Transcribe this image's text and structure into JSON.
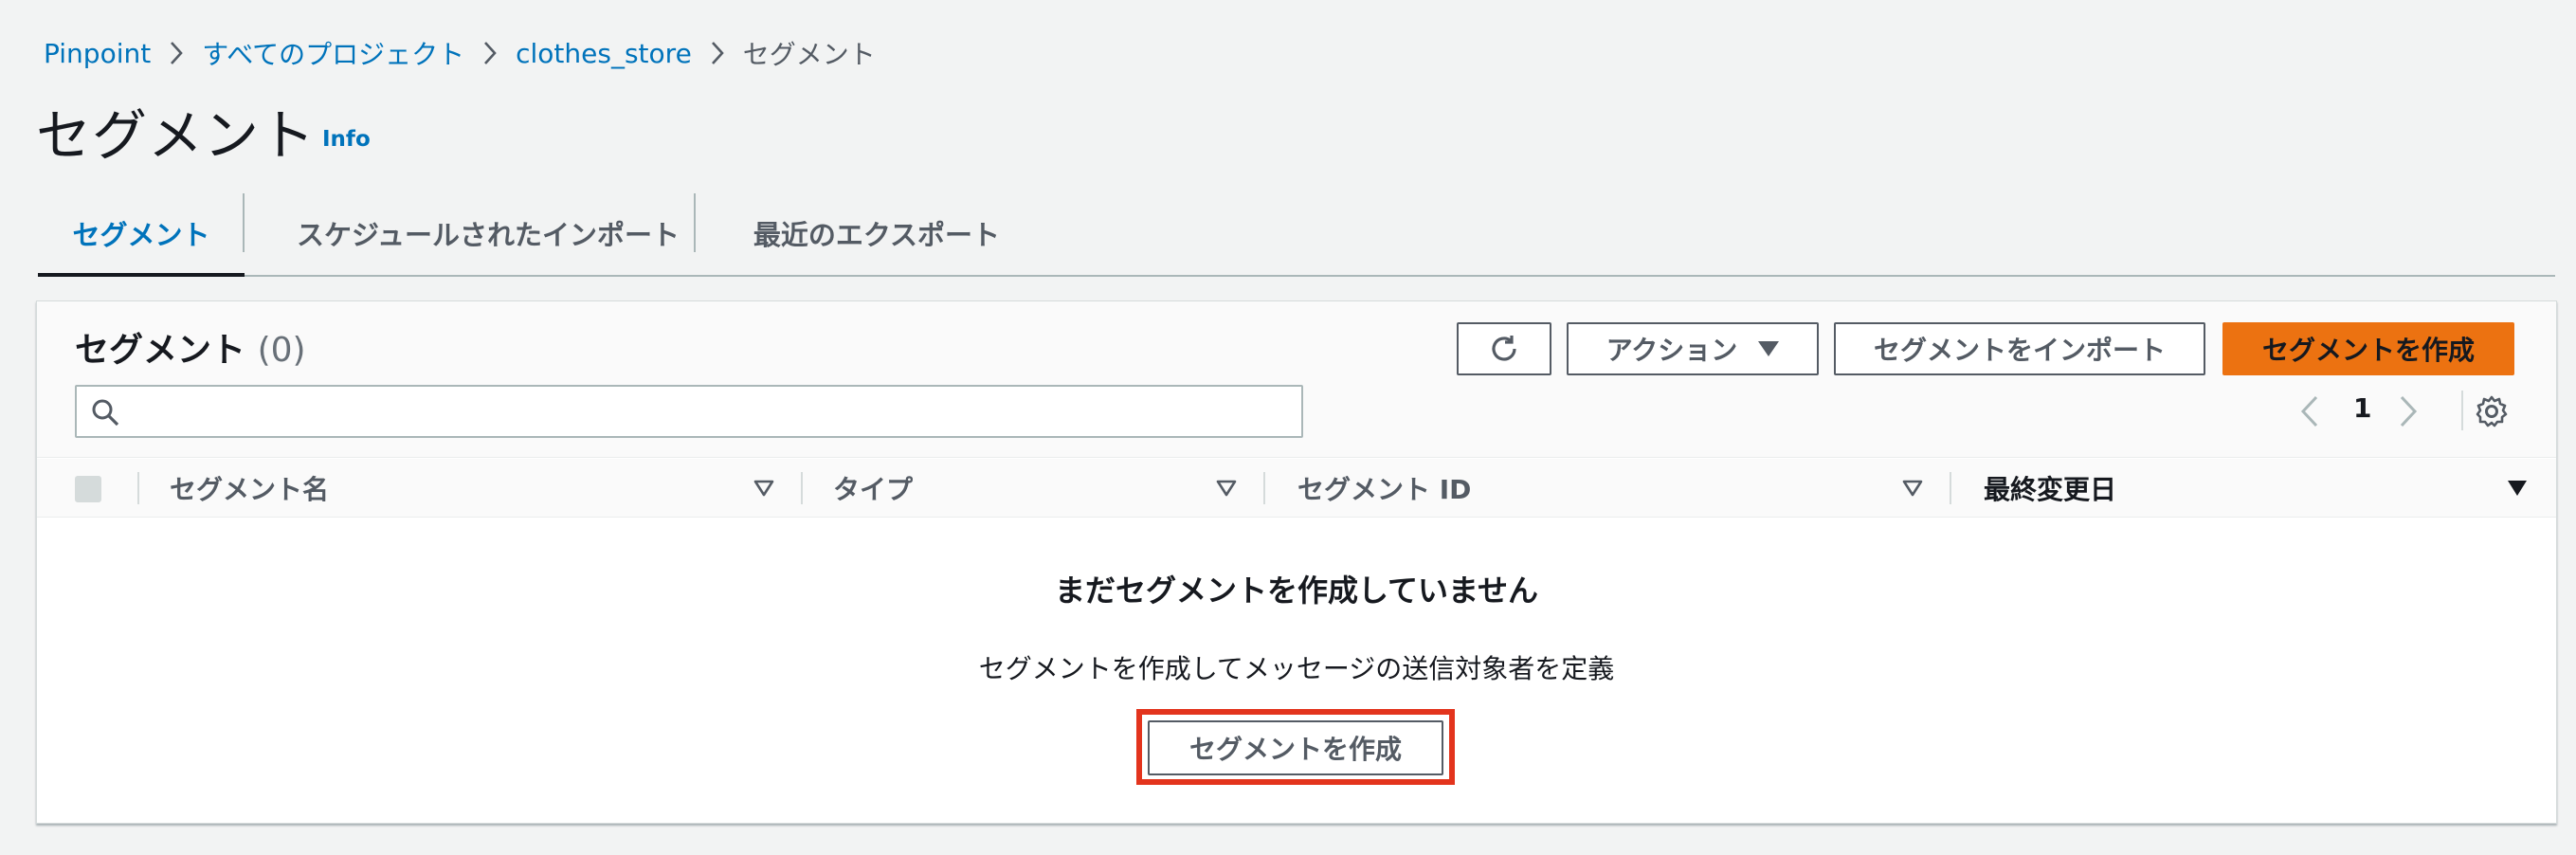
{
  "breadcrumb": {
    "items": [
      "Pinpoint",
      "すべてのプロジェクト",
      "clothes_store"
    ],
    "current": "セグメント"
  },
  "page": {
    "title": "セグメント",
    "info_label": "Info"
  },
  "tabs": [
    {
      "label": "セグメント",
      "active": true
    },
    {
      "label": "スケジュールされたインポート",
      "active": false
    },
    {
      "label": "最近のエクスポート",
      "active": false
    }
  ],
  "panel": {
    "title": "セグメント",
    "count": "(0)",
    "buttons": {
      "refresh_icon": "refresh-icon",
      "actions": "アクション",
      "import": "セグメントをインポート",
      "create": "セグメントを作成"
    },
    "search": {
      "value": "",
      "placeholder": ""
    },
    "pagination": {
      "current_page": "1"
    }
  },
  "table": {
    "columns": [
      "セグメント名",
      "タイプ",
      "セグメント ID",
      "最終変更日"
    ]
  },
  "empty_state": {
    "title": "まだセグメントを作成していません",
    "description": "セグメントを作成してメッセージの送信対象者を定義",
    "button": "セグメントを作成"
  },
  "colors": {
    "link": "#0073bb",
    "primary": "#ec7211",
    "highlight": "#e3341d",
    "background": "#f2f3f3"
  }
}
